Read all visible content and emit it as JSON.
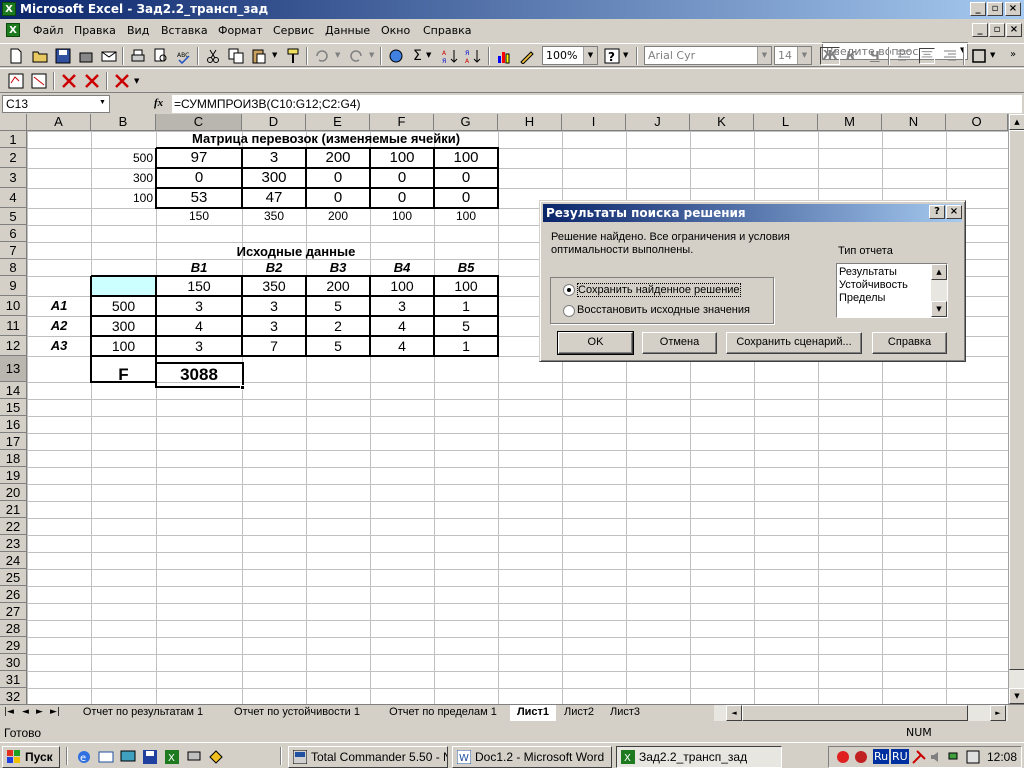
{
  "window": {
    "title": "Microsoft Excel - Зад2.2_трансп_зад",
    "app_icon": "excel-icon"
  },
  "menu": [
    "Файл",
    "Правка",
    "Вид",
    "Вставка",
    "Формат",
    "Сервис",
    "Данные",
    "Окно",
    "Справка"
  ],
  "ask_placeholder": "Введите вопрос",
  "toolbar": {
    "zoom": "100%",
    "font": "Arial Cyr",
    "size": "14",
    "bold": "Ж",
    "italic": "К",
    "underline": "Ч"
  },
  "formula_bar": {
    "cell_ref": "C13",
    "fx": "fx",
    "formula": "=СУММПРОИЗВ(C10:G12;C2:G4)"
  },
  "columns": [
    "A",
    "B",
    "C",
    "D",
    "E",
    "F",
    "G",
    "H",
    "I",
    "J",
    "K",
    "L",
    "M",
    "N",
    "O"
  ],
  "rows": [
    "1",
    "2",
    "3",
    "4",
    "5",
    "6",
    "7",
    "8",
    "9",
    "10",
    "11",
    "12",
    "13",
    "14",
    "15",
    "16",
    "17",
    "18",
    "19",
    "20",
    "21",
    "22",
    "23",
    "24",
    "25",
    "26",
    "27",
    "28",
    "29",
    "30",
    "31",
    "32"
  ],
  "sheet": {
    "title1": "Матрица перевозок (изменяемые ячейки)",
    "supply_top": [
      "500",
      "300",
      "100"
    ],
    "matrix": [
      [
        "97",
        "3",
        "200",
        "100",
        "100"
      ],
      [
        "0",
        "300",
        "0",
        "0",
        "0"
      ],
      [
        "53",
        "47",
        "0",
        "0",
        "0"
      ]
    ],
    "col_sums": [
      "150",
      "350",
      "200",
      "100",
      "100"
    ],
    "title2": "Исходные данные",
    "dest_labels": [
      "B1",
      "B2",
      "B3",
      "B4",
      "B5"
    ],
    "demand": [
      "150",
      "350",
      "200",
      "100",
      "100"
    ],
    "src_labels": [
      "A1",
      "A2",
      "A3"
    ],
    "supply": [
      "500",
      "300",
      "100"
    ],
    "costs": [
      [
        "3",
        "3",
        "5",
        "3",
        "1"
      ],
      [
        "4",
        "3",
        "2",
        "4",
        "5"
      ],
      [
        "3",
        "7",
        "5",
        "4",
        "1"
      ]
    ],
    "f_label": "F",
    "f_value": "3088"
  },
  "tabs": [
    "Отчет по результатам 1",
    "Отчет по устойчивости 1",
    "Отчет по пределам 1",
    "Лист1",
    "Лист2",
    "Лист3"
  ],
  "active_tab": "Лист1",
  "status": {
    "text": "Готово",
    "num": "NUM"
  },
  "dialog": {
    "title": "Результаты поиска решения",
    "message": "Решение найдено. Все ограничения и условия оптимальности выполнены.",
    "report_type_label": "Тип отчета",
    "reports": [
      "Результаты",
      "Устойчивость",
      "Пределы"
    ],
    "option_keep": "Сохранить найденное решение",
    "option_restore": "Восстановить исходные значения",
    "selected_option": "keep",
    "btn_ok": "OK",
    "btn_cancel": "Отмена",
    "btn_save_scenario": "Сохранить сценарий...",
    "btn_help": "Справка"
  },
  "taskbar": {
    "start": "Пуск",
    "tasks": [
      "Total Commander 5.50 - N...",
      "Doc1.2 - Microsoft Word",
      "Зад2.2_трансп_зад"
    ],
    "lang1": "Ru",
    "lang2": "RU",
    "clock": "12:08"
  }
}
